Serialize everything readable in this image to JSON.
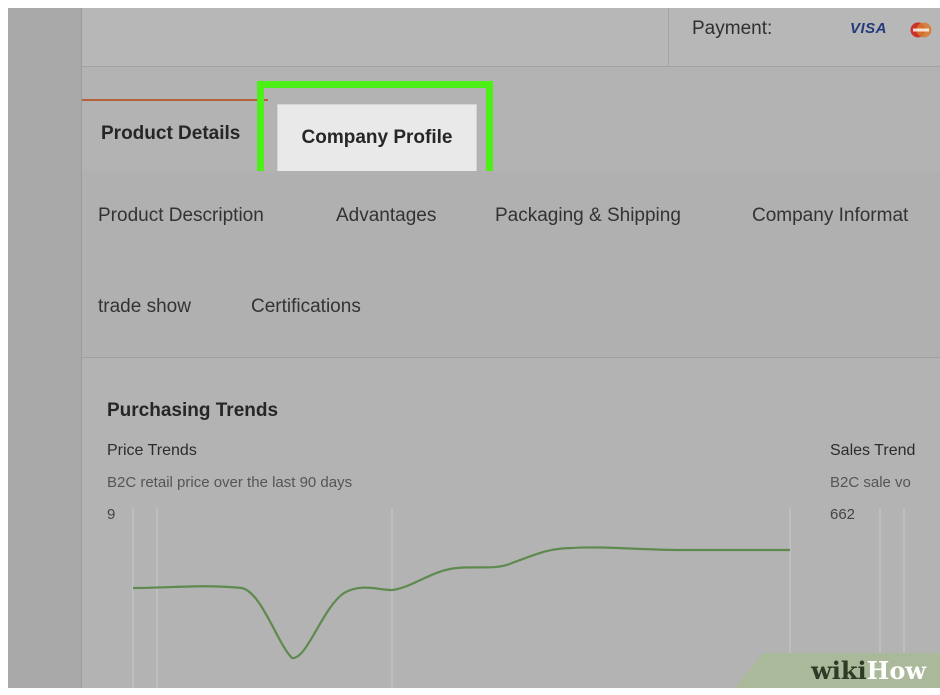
{
  "payment": {
    "label": "Payment:",
    "visa": "VISA"
  },
  "tabs": [
    {
      "label": "Product Details"
    },
    {
      "label": "Company Profile"
    }
  ],
  "subnav": [
    {
      "label": "Product Description"
    },
    {
      "label": "Advantages"
    },
    {
      "label": "Packaging & Shipping"
    },
    {
      "label": "Company Informat"
    },
    {
      "label": "trade show"
    },
    {
      "label": "Certifications"
    }
  ],
  "trends": {
    "title": "Purchasing Trends",
    "price": {
      "title": "Price Trends",
      "subtitle": "B2C retail price over the last 90 days",
      "max": "9"
    },
    "sales": {
      "title": "Sales Trend",
      "subtitle": "B2C sale vo",
      "max": "662"
    }
  },
  "watermark": {
    "part1": "wiki",
    "part2": "How"
  },
  "colors": {
    "highlight": "#4cef18",
    "line": "#5e8a4f",
    "active_tab": "#b4613a"
  }
}
